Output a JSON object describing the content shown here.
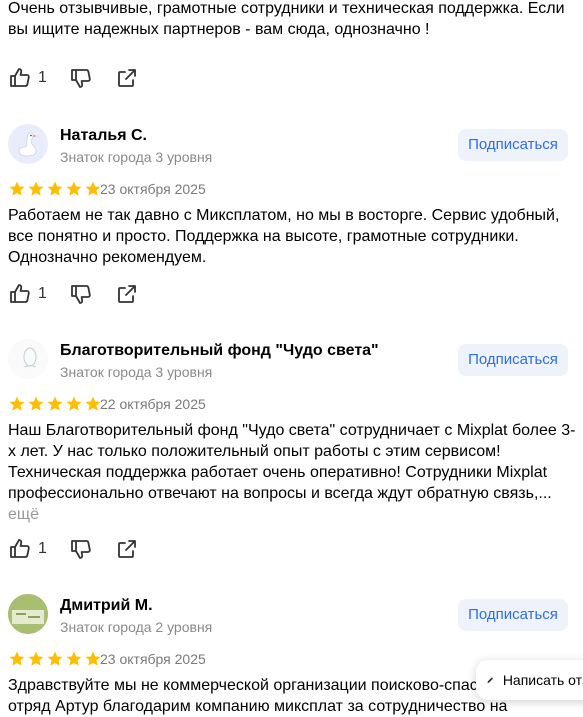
{
  "intro": {
    "text": "Очень отзывчивые, грамотные сотрудники и техническая поддержка. Если вы ищите надежных партнеров - вам сюда, однозначно !",
    "likes": "1"
  },
  "reviews": [
    {
      "name": "Наталья С.",
      "level": "Знаток города 3 уровня",
      "subscribe": "Подписаться",
      "date": "23 октября 2025",
      "rating": 5,
      "text": "Работаем не так давно с Миксплатом, но мы в восторге. Сервис удобный, все понятно и просто. Поддержка на высоте, грамотные сотрудники. Однозначно рекомендуем.",
      "likes": "1",
      "avatar_icon": "goose-avatar-icon"
    },
    {
      "name": "Благотворительный фонд \"Чудо света\"",
      "level": "Знаток города 3 уровня",
      "subscribe": "Подписаться",
      "date": "22 октября 2025",
      "rating": 5,
      "text": "Наш Благотворительный фонд \"Чудо света\" сотрудничает с Mixplat более 3-х лет. У нас только положительный опыт работы с этим сервисом! Техническая поддержка работает очень оперативно! Сотрудники Mixplat профессионально отвечают на вопросы и всегда ждут обратную связь,...",
      "more": "ещё",
      "likes": "1",
      "avatar_icon": "foundation-logo-icon"
    },
    {
      "name": "Дмитрий М.",
      "level": "Знаток города 2 уровня",
      "subscribe": "Подписаться",
      "date": "23 октября 2025",
      "rating": 5,
      "text": "Здравствуйте мы не коммерческой организации поисково-спасательный отряд Артур благодарим компанию миксплат за сотрудничество на",
      "avatar_icon": "green-photo-avatar-icon"
    }
  ],
  "write_button": {
    "label": "Написать отзыв"
  },
  "colors": {
    "star": "#ffbf00",
    "accent": "#2f6fe0",
    "subscribe_bg": "#eef2fb"
  }
}
